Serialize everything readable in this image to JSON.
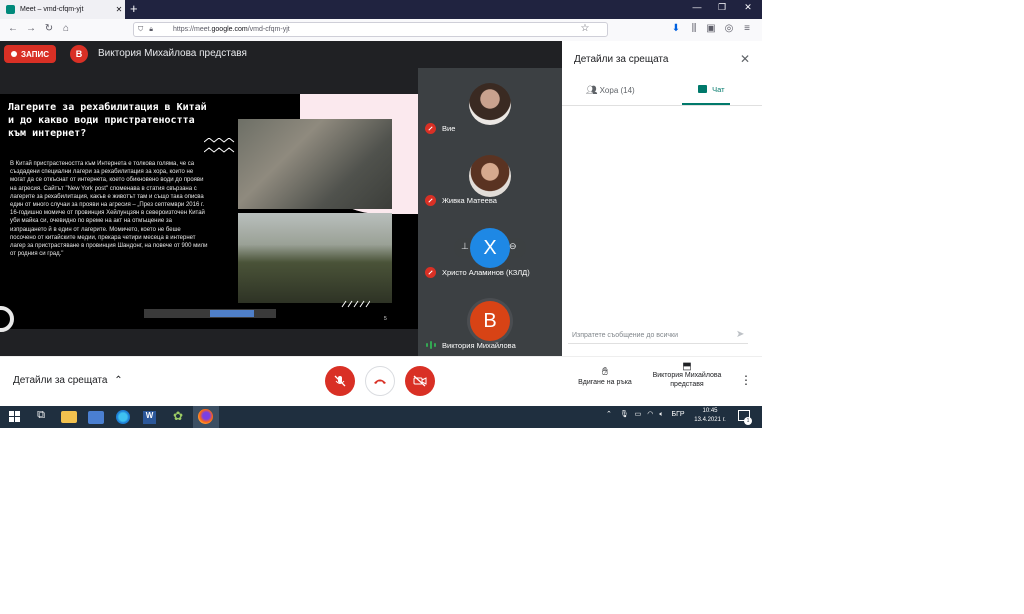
{
  "browser": {
    "tab_title": "Meet – vmd-cfqm-yjt",
    "tab_close": "✕",
    "new_tab": "+",
    "url_prefix": "https://meet.",
    "url_domain": "google.com",
    "url_path": "/vmd-cfqm-yjt",
    "window_controls": [
      "—",
      "❐",
      "✕"
    ]
  },
  "meeting": {
    "record_label": "ЗАПИС",
    "presenter_initial": "В",
    "presenter_text": "Виктория Михайлова представя"
  },
  "slide": {
    "title": "Лагерите за рехабилитация в Китай и до какво води пристратеността към интернет?",
    "body": "В Китай пристрастеността към Интернета е толкова голяма, че са създадени специални лагери за рехабилитация за хора, които не могат да се откъснат от интернета, което обикновено води до прояви на агресия. Сайтът \"New York post\" споменава в статия свързана с лагерите за рехабилитация, какъв е животът там и също така описва един от много случаи за прояви на агресия – „През септември 2016 г. 16-годишно момиче от провинция Хейлунцзян в североизточен Китай уби майка си, очевидно по време на акт на отмъщение за изпращането й в един от лагерите. Момичето, което не беше посочено от китайските медии, прекара четири месеца в интернет лагер за пристрастяване в провинция Шандонг, на повече от 900 мили от родния си град.\"",
    "page_number": "5"
  },
  "participants": [
    {
      "name": "Вие",
      "initial": ""
    },
    {
      "name": "Живка Матеева",
      "initial": ""
    },
    {
      "name": "Христо Аламинов (КЗЛД)",
      "initial": "Х"
    },
    {
      "name": "Виктория Михайлова",
      "initial": "В"
    }
  ],
  "panel": {
    "title": "Детайли за срещата",
    "close": "✕",
    "tab_people": "Хора (14)",
    "tab_chat": "Чат",
    "chat_placeholder": "Изпратете съобщение до всички"
  },
  "controls": {
    "meeting_details": "Детайли за срещата",
    "raise_hand": "Вдигане на ръка",
    "presenter_label": "Виктория Михайлова представя"
  },
  "taskbar": {
    "tray_lang": "БГР",
    "time": "10:45",
    "date": "13.4.2021 г.",
    "notif_count": "1"
  },
  "colors": {
    "accent_red": "#d93025",
    "chat_teal": "#00796b",
    "stage_bg": "#202124",
    "tiles_bg": "#3c4043"
  }
}
